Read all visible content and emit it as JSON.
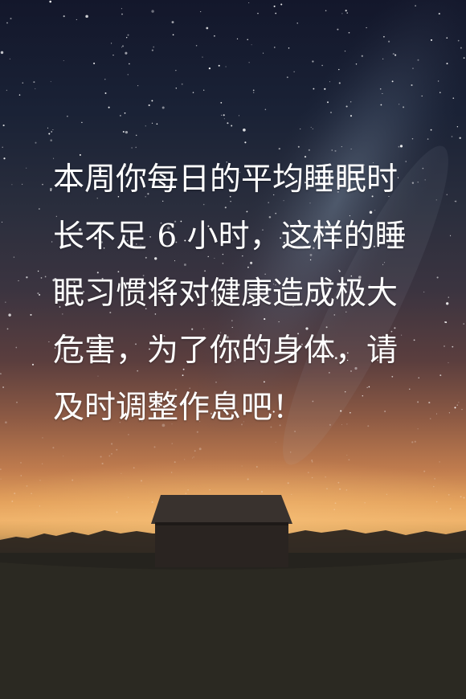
{
  "message": {
    "text": "本周你每日的平均睡眠时长不足 6 小时，这样的睡眠习惯将对健康造成极大危害，为了你的身体，请及时调整作息吧！"
  },
  "background": {
    "description_icon": "night-sky-barn-photo",
    "colors": {
      "sky_top": "#13172b",
      "horizon_glow": "#efb26a",
      "ground": "#1f1f1a",
      "text": "#ffffff"
    }
  }
}
